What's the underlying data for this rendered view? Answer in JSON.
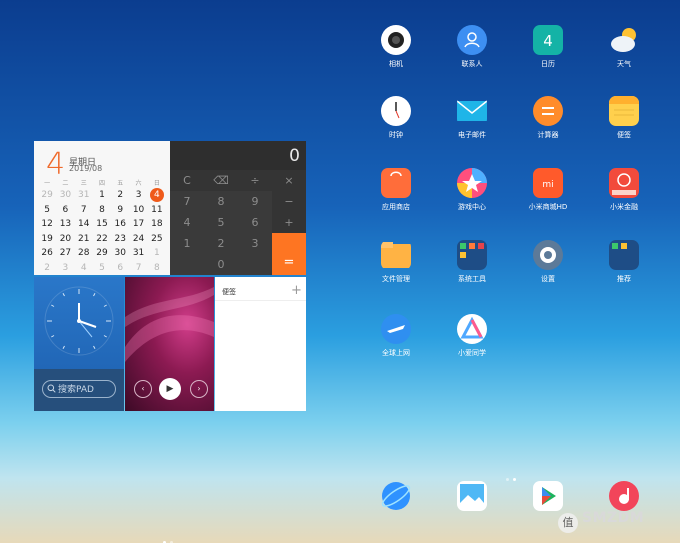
{
  "calendar": {
    "day": "4",
    "weekday": "星期日",
    "date": "2019/08",
    "headers": [
      "一",
      "二",
      "三",
      "四",
      "五",
      "六",
      "日"
    ],
    "rows": [
      [
        "29",
        "30",
        "31",
        "1",
        "2",
        "3",
        "4"
      ],
      [
        "5",
        "6",
        "7",
        "8",
        "9",
        "10",
        "11"
      ],
      [
        "12",
        "13",
        "14",
        "15",
        "16",
        "17",
        "18"
      ],
      [
        "19",
        "20",
        "21",
        "22",
        "23",
        "24",
        "25"
      ],
      [
        "26",
        "27",
        "28",
        "29",
        "30",
        "31",
        "1"
      ],
      [
        "2",
        "3",
        "4",
        "5",
        "6",
        "7",
        "8"
      ]
    ],
    "accent": "#ef5a1a"
  },
  "calculator": {
    "display": "0",
    "keys": [
      "C",
      "⌫",
      "÷",
      "×",
      "7",
      "8",
      "9",
      "−",
      "4",
      "5",
      "6",
      "+",
      "1",
      "2",
      "3",
      "",
      "",
      "0",
      "",
      ""
    ],
    "equals": "=",
    "accent": "#fe7522"
  },
  "search_widget": {
    "placeholder": "搜索PAD"
  },
  "music_widget": {
    "prev": "‹",
    "play": "▶",
    "next": "›"
  },
  "notes_widget": {
    "title": "便签",
    "add": "+"
  },
  "apps": [
    {
      "label": "相机",
      "icon": "camera-icon"
    },
    {
      "label": "联系人",
      "icon": "contacts-icon"
    },
    {
      "label": "日历",
      "icon": "calendar-icon",
      "badge": "4"
    },
    {
      "label": "天气",
      "icon": "weather-icon"
    },
    {
      "label": "时钟",
      "icon": "clock-icon"
    },
    {
      "label": "电子邮件",
      "icon": "mail-icon"
    },
    {
      "label": "计算器",
      "icon": "calculator-icon"
    },
    {
      "label": "便签",
      "icon": "notes-icon"
    },
    {
      "label": "应用商店",
      "icon": "app-store-icon"
    },
    {
      "label": "游戏中心",
      "icon": "game-center-icon"
    },
    {
      "label": "小米商城HD",
      "icon": "mi-store-icon",
      "badge": "mi"
    },
    {
      "label": "小米金融",
      "icon": "mi-finance-icon"
    },
    {
      "label": "文件管理",
      "icon": "file-manager-icon"
    },
    {
      "label": "系统工具",
      "icon": "system-tools-icon"
    },
    {
      "label": "设置",
      "icon": "settings-icon"
    },
    {
      "label": "推荐",
      "icon": "recommend-icon"
    },
    {
      "label": "全球上网",
      "icon": "global-internet-icon"
    },
    {
      "label": "小爱同学",
      "icon": "xiaoai-icon"
    }
  ],
  "dock": [
    {
      "icon": "browser-icon"
    },
    {
      "icon": "gallery-icon"
    },
    {
      "icon": "play-store-icon"
    },
    {
      "icon": "music-icon"
    }
  ],
  "watermark": {
    "text": "SMZDM"
  }
}
